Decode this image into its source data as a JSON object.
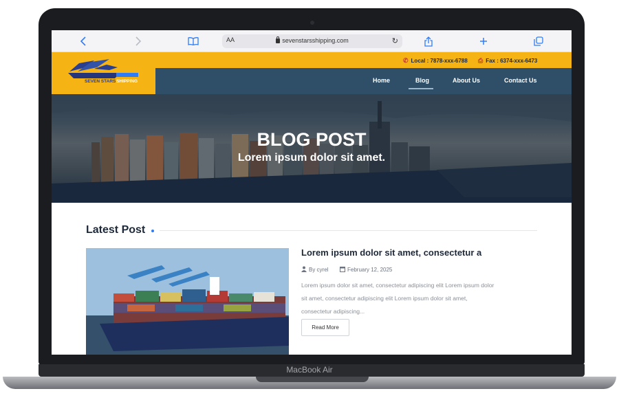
{
  "device": {
    "label": "MacBook Air"
  },
  "browser": {
    "url": "sevenstarsshipping.com",
    "text_size_label": "AA"
  },
  "site": {
    "brand": {
      "line1": "SEVEN STARS",
      "line2": "SHIPPING"
    },
    "contact": {
      "local": "Local : 7878-xxx-6788",
      "fax": "Fax : 6374-xxx-6473"
    },
    "nav": [
      {
        "label": "Home"
      },
      {
        "label": "Blog"
      },
      {
        "label": "About Us"
      },
      {
        "label": "Contact Us"
      }
    ],
    "hero": {
      "title": "BLOG POST",
      "subtitle": "Lorem ipsum dolor sit amet."
    },
    "section": {
      "title": "Latest Post"
    },
    "post": {
      "title": "Lorem ipsum dolor sit amet, consectetur a",
      "author": "By cyrel",
      "date": "February 12, 2025",
      "excerpt_lines": [
        "Lorem ipsum dolor sit amet, consectetur adipiscing elit Lorem ipsum dolor",
        "sit amet, consectetur adipiscing elit Lorem ipsum dolor sit amet,",
        "consectetur adipiscing..."
      ],
      "read_more": "Read More"
    }
  },
  "colors": {
    "accent_yellow": "#f5b314",
    "nav_blue": "#2f4f68",
    "link_blue": "#2f7cf6",
    "text_dark": "#1d2838"
  },
  "icons": [
    "back-icon",
    "forward-icon",
    "book-icon",
    "lock-icon",
    "reload-icon",
    "share-icon",
    "plus-icon",
    "tabs-icon",
    "phone-icon",
    "fax-icon",
    "user-icon",
    "calendar-icon"
  ]
}
